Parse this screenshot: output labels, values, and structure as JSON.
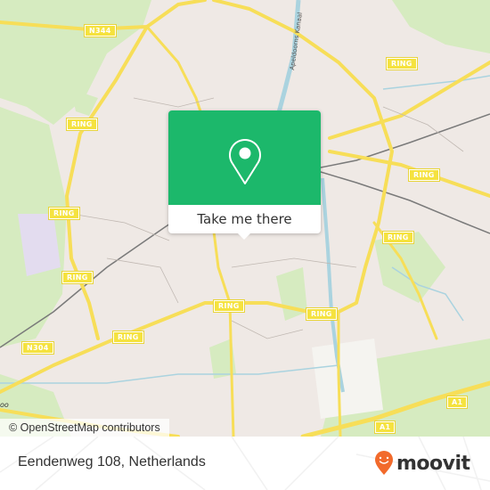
{
  "map": {
    "road_labels": [
      {
        "id": "n344",
        "text": "N344"
      },
      {
        "id": "ring-top-right",
        "text": "RING"
      },
      {
        "id": "ring-left-upper",
        "text": "RING"
      },
      {
        "id": "ring-left-middle",
        "text": "RING"
      },
      {
        "id": "ring-left-lower",
        "text": "RING"
      },
      {
        "id": "ring-bottom-left",
        "text": "RING"
      },
      {
        "id": "ring-center-bottom",
        "text": "RING"
      },
      {
        "id": "ring-center-right-bottom",
        "text": "RING"
      },
      {
        "id": "ring-right-upper",
        "text": "RING"
      },
      {
        "id": "ring-right-middle",
        "text": "RING"
      },
      {
        "id": "n304",
        "text": "N304"
      },
      {
        "id": "a1-left",
        "text": "A1"
      },
      {
        "id": "a1-right",
        "text": "A1"
      }
    ],
    "canal_label": "Apeldoorns Kanaal",
    "edge_text": "oo",
    "attribution": "© OpenStreetMap contributors",
    "colors": {
      "land": "#efe9e5",
      "park": "#cde8b0",
      "water": "#aad3df",
      "road": "#f7de58",
      "railway": "#777777"
    }
  },
  "popup": {
    "button_label": "Take me there",
    "icon": "location-pin-icon",
    "color": "#1cb86b"
  },
  "footer": {
    "address": "Eendenweg 108, Netherlands",
    "brand": "moovit",
    "brand_color": "#f26a2b"
  }
}
